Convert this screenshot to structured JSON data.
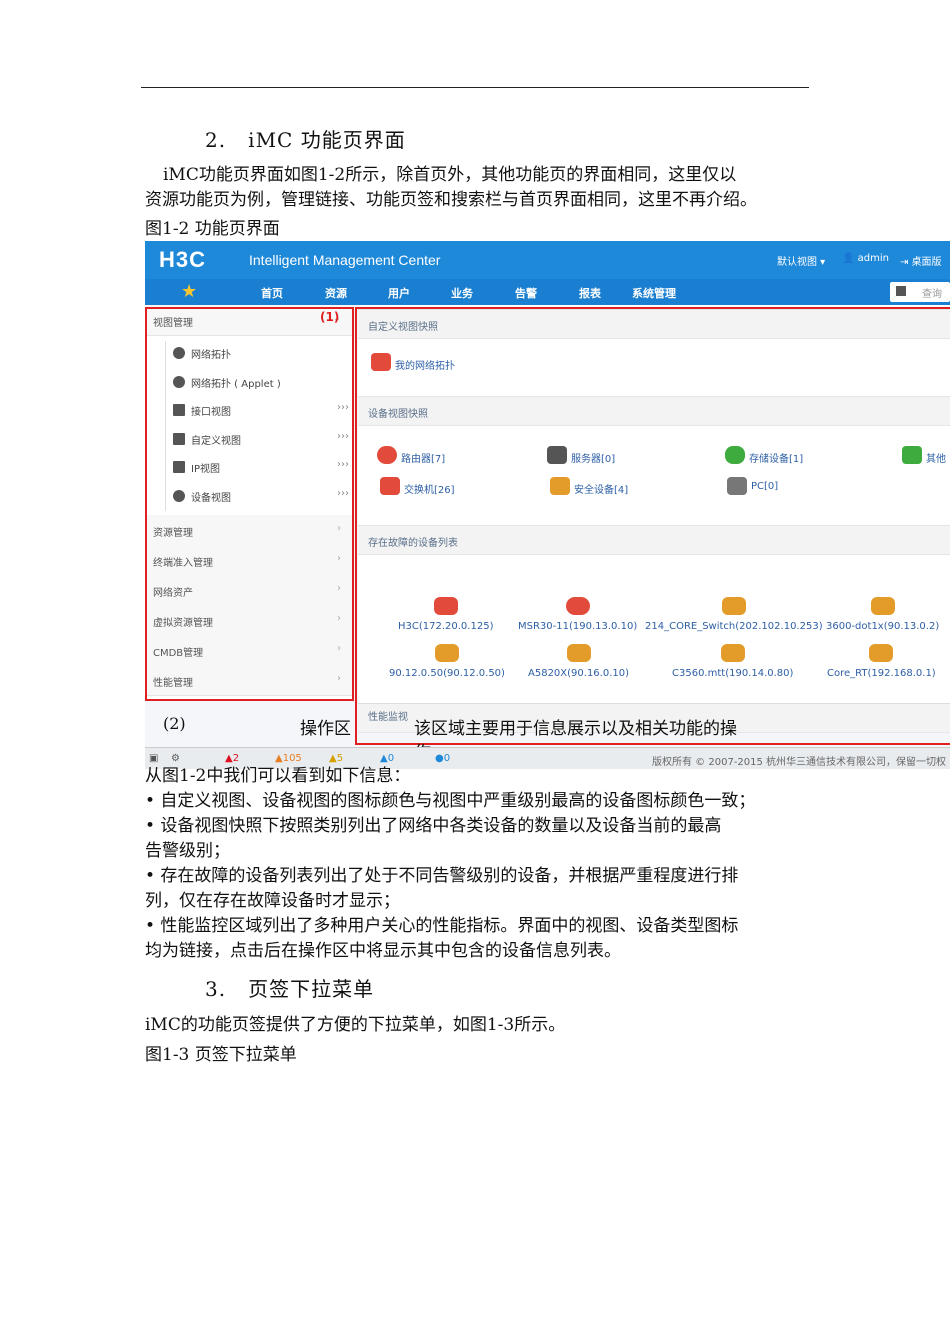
{
  "section2": {
    "number": "2.",
    "title": "iMC 功能页界面"
  },
  "para1": [
    "iMC功能页界面如图1-2所示，除首页外，其他功能页的界面相同，这里仅以",
    "资源功能页为例，管理链接、功能页签和搜索栏与首页界面相同，这里不再介绍。"
  ],
  "figure1_caption": "图1-2 功能页界面",
  "screenshot": {
    "logo": "H3C",
    "app_name": "Intelligent Management Center",
    "view_menu": "默认视图",
    "user": "admin",
    "desktop": "桌面版",
    "nav": [
      "首页",
      "资源",
      "用户",
      "业务",
      "告警",
      "报表",
      "系统管理"
    ],
    "search_placeholder": "查询",
    "sidebar": {
      "head": "视图管理",
      "items": [
        {
          "label": "网络拓扑",
          "arrow": ""
        },
        {
          "label": "网络拓扑 ( Applet )",
          "arrow": ""
        },
        {
          "label": "接口视图",
          "arrow": "›››"
        },
        {
          "label": "自定义视图",
          "arrow": "›››"
        },
        {
          "label": "IP视图",
          "arrow": "›››"
        },
        {
          "label": "设备视图",
          "arrow": "›››"
        }
      ],
      "groups": [
        "资源管理",
        "终端准入管理",
        "网络资产",
        "虚拟资源管理",
        "CMDB管理",
        "性能管理"
      ]
    },
    "marker1": "(1)",
    "custom_view_head": "自定义视图快照",
    "custom_view_item": "我的网络拓扑",
    "device_view_head": "设备视图快照",
    "devices": [
      "路由器[7]",
      "服务器[0]",
      "存储设备[1]",
      "其他",
      "交换机[26]",
      "安全设备[4]",
      "PC[0]"
    ],
    "fault_head": "存在故障的设备列表",
    "faults_row1": [
      "H3C(172.20.0.125)",
      "MSR30-11(190.13.0.10)",
      "214_CORE_Switch(202.102.10.253)",
      "3600-dot1x(90.13.0.2)"
    ],
    "faults_row2": [
      "90.12.0.50(90.12.0.50)",
      "A5820X(90.16.0.10)",
      "C3560.mtt(190.14.0.80)",
      "Core_RT(192.168.0.1)"
    ],
    "perf_head": "性能监视",
    "status": [
      "2",
      "105",
      "5",
      "0",
      "0"
    ],
    "copyright": "版权所有 © 2007-2015 杭州华三通信技术有限公司，保留一切权",
    "overlay_marker2": "(2)",
    "overlay_area": "操作区",
    "overlay_desc1": "该区域主要用于信息展示以及相关功能的操",
    "overlay_desc2": "作"
  },
  "para2": [
    "从图1-2中我们可以看到如下信息：",
    "• 自定义视图、设备视图的图标颜色与视图中严重级别最高的设备图标颜色一致；",
    "• 设备视图快照下按照类别列出了网络中各类设备的数量以及设备当前的最高",
    "告警级别；",
    "• 存在故障的设备列表列出了处于不同告警级别的设备，并根据严重程度进行排",
    "列，仅在存在故障设备时才显示；",
    "• 性能监控区域列出了多种用户关心的性能指标。界面中的视图、设备类型图标",
    "均为链接，点击后在操作区中将显示其中包含的设备信息列表。"
  ],
  "section3": {
    "number": "3.",
    "title": "页签下拉菜单"
  },
  "para3": "iMC的功能页签提供了方便的下拉菜单，如图1-3所示。",
  "figure2_caption": "图1-3 页签下拉菜单",
  "colors": {
    "brand_blue": "#1e88d9",
    "red_box": "#e02020"
  }
}
